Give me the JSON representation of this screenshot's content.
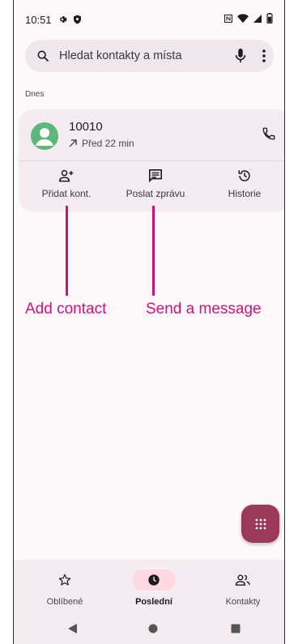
{
  "status_bar": {
    "time": "10:51",
    "icons": [
      "settings-icon",
      "shield-icon",
      "nfc-icon",
      "wifi-icon",
      "signal-icon",
      "battery-icon"
    ]
  },
  "search": {
    "placeholder": "Hledat kontakty a místa",
    "icons": [
      "search-icon",
      "mic-icon",
      "more-vert-icon"
    ]
  },
  "section_label": "Dnes",
  "call_log": [
    {
      "number": "10010",
      "time": "Před 22 min",
      "direction_icon": "outgoing-call-arrow-icon",
      "avatar_color": "#5db779",
      "actions": [
        {
          "label": "Přidat kont.",
          "icon": "add-person-icon"
        },
        {
          "label": "Poslat zprávu",
          "icon": "message-icon"
        },
        {
          "label": "Historie",
          "icon": "history-icon"
        }
      ]
    }
  ],
  "annotations": [
    {
      "text": "Add contact"
    },
    {
      "text": "Send a message"
    }
  ],
  "fab": {
    "icon": "dialpad-icon",
    "color": "#9a3a58"
  },
  "bottom_nav": {
    "items": [
      {
        "label": "Oblíbené",
        "icon": "star-icon",
        "active": false
      },
      {
        "label": "Poslední",
        "icon": "clock-icon",
        "active": true
      },
      {
        "label": "Kontakty",
        "icon": "people-icon",
        "active": false
      }
    ]
  },
  "system_nav": [
    "back-icon",
    "home-icon",
    "recents-icon"
  ],
  "colors": {
    "accent": "#d1127c",
    "nav_active_pill": "#ffd9e2",
    "card_bg": "#f4ecf0"
  }
}
